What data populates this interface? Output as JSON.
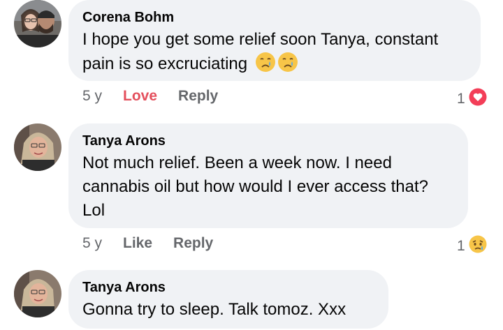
{
  "comments": [
    {
      "author": "Corena Bohm",
      "lines": [
        "I hope you get some relief soon Tanya, constant",
        "pain is so excruciating"
      ],
      "time": "5 y",
      "react_label": "Love",
      "reply_label": "Reply",
      "reaction_count": "1",
      "reaction_icon": "heart-icon",
      "emojis": [
        "crying-face-emoji",
        "crying-face-emoji"
      ]
    },
    {
      "author": "Tanya Arons",
      "lines": [
        "Not much relief. Been a week now.  I need",
        "cannabis oil but how would I ever access that?",
        "Lol"
      ],
      "time": "5 y",
      "react_label": "Like",
      "reply_label": "Reply",
      "reaction_count": "1",
      "reaction_icon": "sad-face-icon"
    },
    {
      "author": "Tanya Arons",
      "lines": [
        "Gonna try to sleep.  Talk tomoz.  Xxx"
      ]
    }
  ],
  "colors": {
    "bubble": "#f0f2f5",
    "love": "#e4505d",
    "meta": "#65676b"
  }
}
